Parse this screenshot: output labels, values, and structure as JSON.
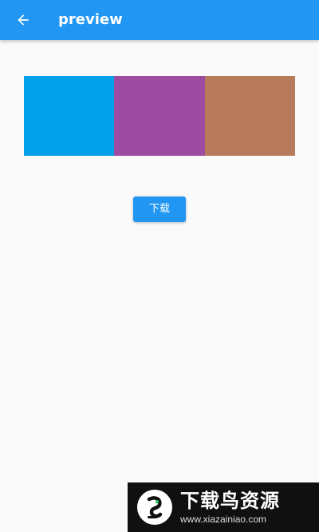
{
  "appbar": {
    "title": "preview",
    "back_icon": "arrow-back-icon",
    "color": "#2196f3"
  },
  "swatches": [
    {
      "color": "#03a1e9"
    },
    {
      "color": "#9e4ba2"
    },
    {
      "color": "#b77b5b"
    }
  ],
  "download_button": {
    "label": "下载",
    "color": "#2196f3"
  },
  "watermark": {
    "title": "下载鸟资源",
    "url": "www.xiazainiao.com",
    "logo_icon": "bird-logo-icon"
  }
}
